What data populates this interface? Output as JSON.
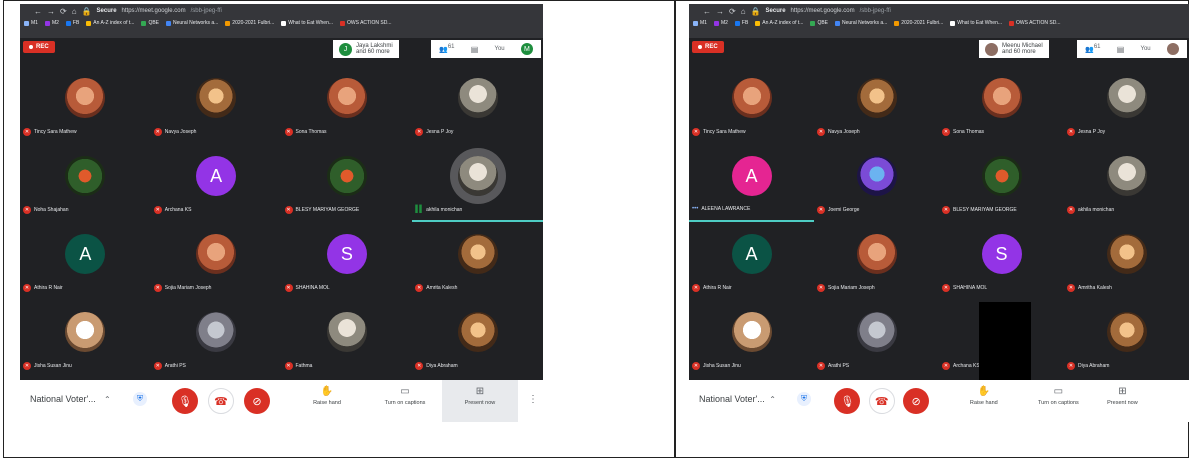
{
  "panels": [
    {
      "browser": {
        "url_secure": "Secure",
        "url_host": "https://meet.google.com",
        "url_path": "/sbb-jpeg-ffi",
        "bookmarks": [
          "M1",
          "M2",
          "FB",
          "An A-Z index of t...",
          "QBE",
          "Neural Networks a...",
          "2020-2021 Fulbri...",
          "What to Eat When...",
          "OWS ACTION SD..."
        ]
      },
      "rec_label": "REC",
      "participants": {
        "avatar": "J",
        "line1": "Jaya Lakshmi",
        "line2": "and 60 more"
      },
      "people_count": "61",
      "you_label": "You",
      "me_avatar": "M",
      "tiles": [
        {
          "name": "Tincy Sara Mathew",
          "kind": "photo",
          "style": "alt4",
          "mic": "muted"
        },
        {
          "name": "Navya Joseph",
          "kind": "photo",
          "style": "alt1",
          "mic": "muted"
        },
        {
          "name": "Sona Thomas",
          "kind": "photo",
          "style": "alt4",
          "mic": "muted"
        },
        {
          "name": "Jesna P Joy",
          "kind": "photo",
          "style": "alt2",
          "mic": "muted"
        },
        {
          "name": "Noha Shajahan",
          "kind": "photo",
          "style": "alt3",
          "mic": "muted"
        },
        {
          "name": "Archana KS",
          "kind": "letter",
          "letter": "A",
          "color": "#9334e6",
          "mic": "muted"
        },
        {
          "name": "BLESY MARIYAM GEORGE",
          "kind": "photo",
          "style": "alt3",
          "mic": "muted"
        },
        {
          "name": "akhila monichan",
          "kind": "photo",
          "style": "alt2",
          "mic": "speaking",
          "speaking": true
        },
        {
          "name": "Athira R Nair",
          "kind": "letter",
          "letter": "A",
          "color": "#0b5345",
          "mic": "muted"
        },
        {
          "name": "Sojia Mariam Joseph",
          "kind": "photo",
          "style": "alt4",
          "mic": "muted"
        },
        {
          "name": "SHAHINA MOL",
          "kind": "letter",
          "letter": "S",
          "color": "#9334e6",
          "mic": "muted"
        },
        {
          "name": "Amrita Kalesh",
          "kind": "photo",
          "style": "alt1",
          "mic": "muted"
        },
        {
          "name": "Jisha Susan Jinu",
          "kind": "photo",
          "style": "alt7",
          "mic": "muted"
        },
        {
          "name": "Arathi PS",
          "kind": "photo",
          "style": "alt5",
          "mic": "muted"
        },
        {
          "name": "Fathma",
          "kind": "photo",
          "style": "alt2",
          "mic": "muted"
        },
        {
          "name": "Diya Abraham",
          "kind": "photo",
          "style": "alt1",
          "mic": "muted"
        }
      ],
      "controls": {
        "meeting_name": "National Voter'...",
        "raise_hand": "Raise hand",
        "captions": "Turn on captions",
        "present": "Present now"
      }
    },
    {
      "browser": {
        "url_secure": "Secure",
        "url_host": "https://meet.google.com",
        "url_path": "/sbb-jpeg-ffi",
        "bookmarks": [
          "M1",
          "M2",
          "FB",
          "An A-Z index of t...",
          "QBE",
          "Neural Networks a...",
          "2020-2021 Fulbri...",
          "What to Eat When...",
          "OWS ACTION SD..."
        ]
      },
      "rec_label": "REC",
      "participants": {
        "avatar": "",
        "line1": "Meenu Michael",
        "line2": "and 60 more"
      },
      "people_count": "61",
      "you_label": "You",
      "me_avatar": "",
      "tiles": [
        {
          "name": "Tincy Sara Mathew",
          "kind": "photo",
          "style": "alt4",
          "mic": "muted"
        },
        {
          "name": "Navya Joseph",
          "kind": "photo",
          "style": "alt1",
          "mic": "muted"
        },
        {
          "name": "Sona Thomas",
          "kind": "photo",
          "style": "alt4",
          "mic": "muted"
        },
        {
          "name": "Jesna P Joy",
          "kind": "photo",
          "style": "alt2",
          "mic": "muted"
        },
        {
          "name": "ALEENA LAWRANCE",
          "kind": "letter",
          "letter": "A",
          "color": "#e52592",
          "mic": "speaking-dots",
          "speaking": true
        },
        {
          "name": "Joemi George",
          "kind": "photo",
          "style": "alt6",
          "mic": "muted"
        },
        {
          "name": "BLESY MARIYAM GEORGE",
          "kind": "photo",
          "style": "alt3",
          "mic": "muted"
        },
        {
          "name": "akhila monichan",
          "kind": "photo",
          "style": "alt2",
          "mic": "muted"
        },
        {
          "name": "Athira R Nair",
          "kind": "letter",
          "letter": "A",
          "color": "#0b5345",
          "mic": "muted"
        },
        {
          "name": "Sojia Mariam Joseph",
          "kind": "photo",
          "style": "alt4",
          "mic": "muted"
        },
        {
          "name": "SHAHINA MOL",
          "kind": "letter",
          "letter": "S",
          "color": "#9334e6",
          "mic": "muted"
        },
        {
          "name": "Amritha Kalesh",
          "kind": "photo",
          "style": "alt1",
          "mic": "muted"
        },
        {
          "name": "Jisha Susan Jinu",
          "kind": "photo",
          "style": "alt7",
          "mic": "muted"
        },
        {
          "name": "Arathi PS",
          "kind": "photo",
          "style": "alt5",
          "mic": "muted"
        },
        {
          "name": "Archana KS",
          "kind": "blank",
          "mic": "muted"
        },
        {
          "name": "Diya Abraham",
          "kind": "photo",
          "style": "alt1",
          "mic": "muted"
        }
      ],
      "controls": {
        "meeting_name": "National Voter'...",
        "raise_hand": "Raise hand",
        "captions": "Turn on captions",
        "present": "Present now"
      }
    }
  ],
  "colors": {
    "meet_bg": "#202124",
    "mute_red": "#d93025",
    "speaking_bar": "#4ecdc4"
  }
}
